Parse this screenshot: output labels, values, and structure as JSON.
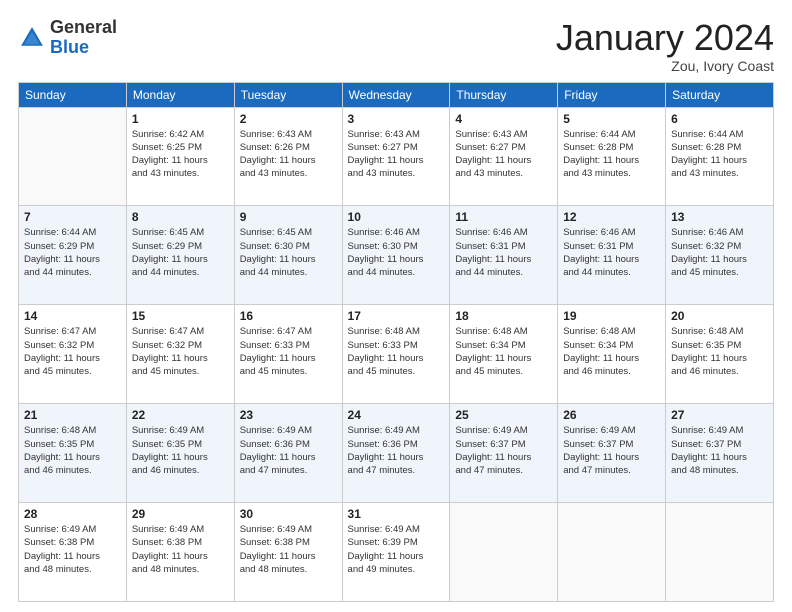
{
  "header": {
    "logo_general": "General",
    "logo_blue": "Blue",
    "month_title": "January 2024",
    "location": "Zou, Ivory Coast"
  },
  "weekdays": [
    "Sunday",
    "Monday",
    "Tuesday",
    "Wednesday",
    "Thursday",
    "Friday",
    "Saturday"
  ],
  "weeks": [
    [
      {
        "day": "",
        "sunrise": "",
        "sunset": "",
        "daylight": ""
      },
      {
        "day": "1",
        "sunrise": "Sunrise: 6:42 AM",
        "sunset": "Sunset: 6:25 PM",
        "daylight": "Daylight: 11 hours and 43 minutes."
      },
      {
        "day": "2",
        "sunrise": "Sunrise: 6:43 AM",
        "sunset": "Sunset: 6:26 PM",
        "daylight": "Daylight: 11 hours and 43 minutes."
      },
      {
        "day": "3",
        "sunrise": "Sunrise: 6:43 AM",
        "sunset": "Sunset: 6:27 PM",
        "daylight": "Daylight: 11 hours and 43 minutes."
      },
      {
        "day": "4",
        "sunrise": "Sunrise: 6:43 AM",
        "sunset": "Sunset: 6:27 PM",
        "daylight": "Daylight: 11 hours and 43 minutes."
      },
      {
        "day": "5",
        "sunrise": "Sunrise: 6:44 AM",
        "sunset": "Sunset: 6:28 PM",
        "daylight": "Daylight: 11 hours and 43 minutes."
      },
      {
        "day": "6",
        "sunrise": "Sunrise: 6:44 AM",
        "sunset": "Sunset: 6:28 PM",
        "daylight": "Daylight: 11 hours and 43 minutes."
      }
    ],
    [
      {
        "day": "7",
        "sunrise": "Sunrise: 6:44 AM",
        "sunset": "Sunset: 6:29 PM",
        "daylight": "Daylight: 11 hours and 44 minutes."
      },
      {
        "day": "8",
        "sunrise": "Sunrise: 6:45 AM",
        "sunset": "Sunset: 6:29 PM",
        "daylight": "Daylight: 11 hours and 44 minutes."
      },
      {
        "day": "9",
        "sunrise": "Sunrise: 6:45 AM",
        "sunset": "Sunset: 6:30 PM",
        "daylight": "Daylight: 11 hours and 44 minutes."
      },
      {
        "day": "10",
        "sunrise": "Sunrise: 6:46 AM",
        "sunset": "Sunset: 6:30 PM",
        "daylight": "Daylight: 11 hours and 44 minutes."
      },
      {
        "day": "11",
        "sunrise": "Sunrise: 6:46 AM",
        "sunset": "Sunset: 6:31 PM",
        "daylight": "Daylight: 11 hours and 44 minutes."
      },
      {
        "day": "12",
        "sunrise": "Sunrise: 6:46 AM",
        "sunset": "Sunset: 6:31 PM",
        "daylight": "Daylight: 11 hours and 44 minutes."
      },
      {
        "day": "13",
        "sunrise": "Sunrise: 6:46 AM",
        "sunset": "Sunset: 6:32 PM",
        "daylight": "Daylight: 11 hours and 45 minutes."
      }
    ],
    [
      {
        "day": "14",
        "sunrise": "Sunrise: 6:47 AM",
        "sunset": "Sunset: 6:32 PM",
        "daylight": "Daylight: 11 hours and 45 minutes."
      },
      {
        "day": "15",
        "sunrise": "Sunrise: 6:47 AM",
        "sunset": "Sunset: 6:32 PM",
        "daylight": "Daylight: 11 hours and 45 minutes."
      },
      {
        "day": "16",
        "sunrise": "Sunrise: 6:47 AM",
        "sunset": "Sunset: 6:33 PM",
        "daylight": "Daylight: 11 hours and 45 minutes."
      },
      {
        "day": "17",
        "sunrise": "Sunrise: 6:48 AM",
        "sunset": "Sunset: 6:33 PM",
        "daylight": "Daylight: 11 hours and 45 minutes."
      },
      {
        "day": "18",
        "sunrise": "Sunrise: 6:48 AM",
        "sunset": "Sunset: 6:34 PM",
        "daylight": "Daylight: 11 hours and 45 minutes."
      },
      {
        "day": "19",
        "sunrise": "Sunrise: 6:48 AM",
        "sunset": "Sunset: 6:34 PM",
        "daylight": "Daylight: 11 hours and 46 minutes."
      },
      {
        "day": "20",
        "sunrise": "Sunrise: 6:48 AM",
        "sunset": "Sunset: 6:35 PM",
        "daylight": "Daylight: 11 hours and 46 minutes."
      }
    ],
    [
      {
        "day": "21",
        "sunrise": "Sunrise: 6:48 AM",
        "sunset": "Sunset: 6:35 PM",
        "daylight": "Daylight: 11 hours and 46 minutes."
      },
      {
        "day": "22",
        "sunrise": "Sunrise: 6:49 AM",
        "sunset": "Sunset: 6:35 PM",
        "daylight": "Daylight: 11 hours and 46 minutes."
      },
      {
        "day": "23",
        "sunrise": "Sunrise: 6:49 AM",
        "sunset": "Sunset: 6:36 PM",
        "daylight": "Daylight: 11 hours and 47 minutes."
      },
      {
        "day": "24",
        "sunrise": "Sunrise: 6:49 AM",
        "sunset": "Sunset: 6:36 PM",
        "daylight": "Daylight: 11 hours and 47 minutes."
      },
      {
        "day": "25",
        "sunrise": "Sunrise: 6:49 AM",
        "sunset": "Sunset: 6:37 PM",
        "daylight": "Daylight: 11 hours and 47 minutes."
      },
      {
        "day": "26",
        "sunrise": "Sunrise: 6:49 AM",
        "sunset": "Sunset: 6:37 PM",
        "daylight": "Daylight: 11 hours and 47 minutes."
      },
      {
        "day": "27",
        "sunrise": "Sunrise: 6:49 AM",
        "sunset": "Sunset: 6:37 PM",
        "daylight": "Daylight: 11 hours and 48 minutes."
      }
    ],
    [
      {
        "day": "28",
        "sunrise": "Sunrise: 6:49 AM",
        "sunset": "Sunset: 6:38 PM",
        "daylight": "Daylight: 11 hours and 48 minutes."
      },
      {
        "day": "29",
        "sunrise": "Sunrise: 6:49 AM",
        "sunset": "Sunset: 6:38 PM",
        "daylight": "Daylight: 11 hours and 48 minutes."
      },
      {
        "day": "30",
        "sunrise": "Sunrise: 6:49 AM",
        "sunset": "Sunset: 6:38 PM",
        "daylight": "Daylight: 11 hours and 48 minutes."
      },
      {
        "day": "31",
        "sunrise": "Sunrise: 6:49 AM",
        "sunset": "Sunset: 6:39 PM",
        "daylight": "Daylight: 11 hours and 49 minutes."
      },
      {
        "day": "",
        "sunrise": "",
        "sunset": "",
        "daylight": ""
      },
      {
        "day": "",
        "sunrise": "",
        "sunset": "",
        "daylight": ""
      },
      {
        "day": "",
        "sunrise": "",
        "sunset": "",
        "daylight": ""
      }
    ]
  ]
}
